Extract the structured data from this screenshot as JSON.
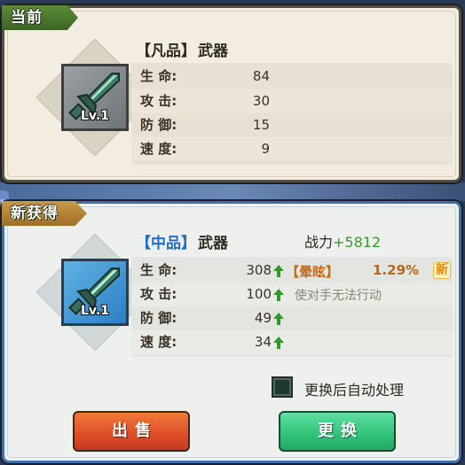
{
  "current": {
    "header": "当前",
    "level": "Lv.1",
    "quality": "【凡品】",
    "item_type": "武器",
    "stats": [
      {
        "label": "生 命:",
        "value": "84"
      },
      {
        "label": "攻 击:",
        "value": "30"
      },
      {
        "label": "防 御:",
        "value": "15"
      },
      {
        "label": "速 度:",
        "value": "9"
      }
    ]
  },
  "new_item": {
    "header": "新获得",
    "level": "Lv.1",
    "quality": "【中品】",
    "item_type": "武器",
    "power_label": "战力",
    "power_value": "+5812",
    "stats": [
      {
        "label": "生 命:",
        "value": "308",
        "trend": "up"
      },
      {
        "label": "攻 击:",
        "value": "100",
        "trend": "up"
      },
      {
        "label": "防 御:",
        "value": "49",
        "trend": "up"
      },
      {
        "label": "速 度:",
        "value": "34",
        "trend": "up"
      }
    ],
    "skill": {
      "name": "【晕眩】",
      "chance": "1.29%",
      "badge": "新",
      "description": "使对手无法行动"
    }
  },
  "auto_process": {
    "label": "更换后自动处理",
    "checked": true
  },
  "buttons": {
    "sell": "出售",
    "swap": "更换"
  },
  "colors": {
    "power_positive": "#3a9a2f",
    "skill_name": "#c86a17",
    "quality_mid": "#1f6fc8",
    "up_arrow": "#2e9a2a"
  },
  "icons": {
    "item": "dagger-icon",
    "stat_trend": "up-arrow-icon",
    "back": "chevron-left-icon"
  }
}
